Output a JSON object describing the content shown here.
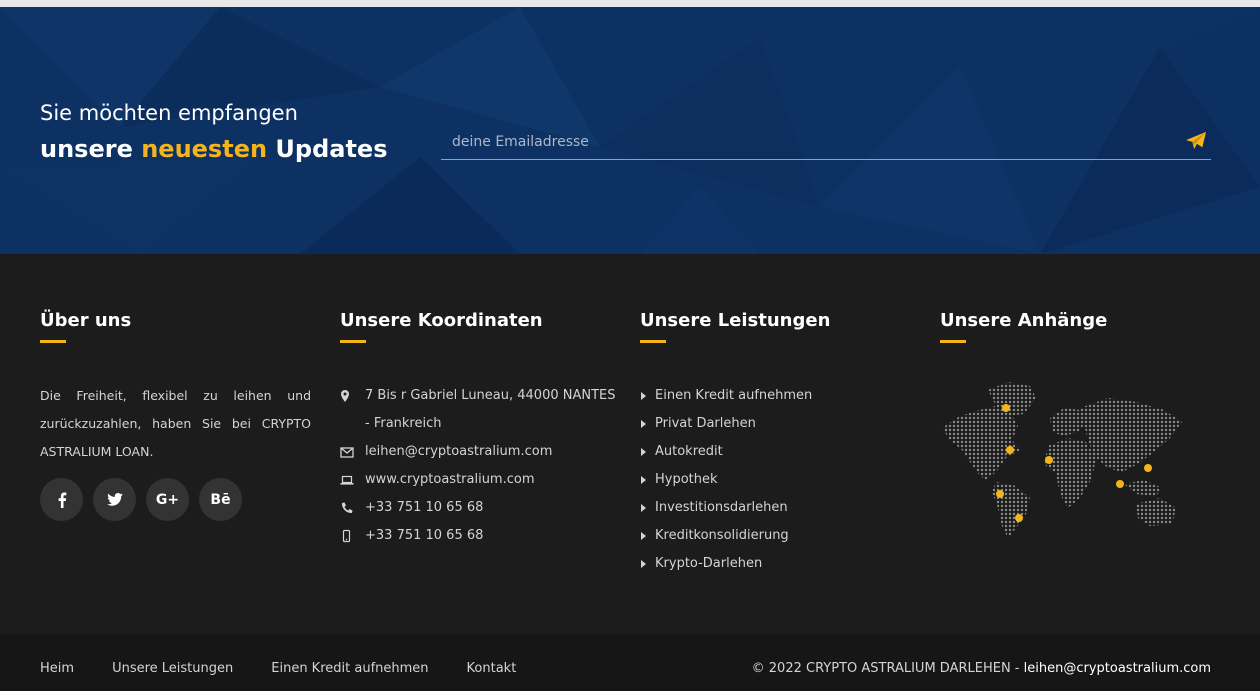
{
  "newsletter": {
    "line1": "Sie möchten empfangen",
    "line2_pre": "unsere ",
    "line2_highlight": "neuesten",
    "line2_post": " Updates",
    "email_placeholder": "deine Emailadresse",
    "send_icon": "paper-plane-icon",
    "bg_color": "#0d3163",
    "accent_color": "#f4b41a"
  },
  "about": {
    "title": "Über uns",
    "text": "Die Freiheit, flexibel zu leihen und zurückzuzahlen, haben Sie bei CRYPTO ASTRALIUM LOAN.",
    "social": [
      {
        "icon": "facebook-icon",
        "glyph": "f"
      },
      {
        "icon": "twitter-icon",
        "glyph": "🐦"
      },
      {
        "icon": "google-plus-icon",
        "glyph": "G+"
      },
      {
        "icon": "behance-icon",
        "glyph": "Bē"
      }
    ]
  },
  "coordinates": {
    "title": "Unsere Koordinaten",
    "items": [
      {
        "icon": "map-marker-icon",
        "text": "7 Bis r Gabriel Luneau, 44000 NANTES - Frankreich"
      },
      {
        "icon": "envelope-icon",
        "text": "leihen@cryptoastralium.com"
      },
      {
        "icon": "laptop-icon",
        "text": "www.cryptoastralium.com"
      },
      {
        "icon": "phone-icon",
        "text": "+33 751 10 65 68"
      },
      {
        "icon": "mobile-icon",
        "text": "+33 751 10 65 68"
      }
    ]
  },
  "services": {
    "title": "Unsere Leistungen",
    "items": [
      "Einen Kredit aufnehmen",
      "Privat Darlehen",
      "Autokredit",
      "Hypothek",
      "Investitionsdarlehen",
      "Kreditkonsolidierung",
      "Krypto-Darlehen"
    ]
  },
  "branches": {
    "title": "Unsere Anhänge",
    "map_icon": "world-map-icon"
  },
  "bottom": {
    "nav": [
      "Heim",
      "Unsere Leistungen",
      "Einen Kredit aufnehmen",
      "Kontakt"
    ],
    "copyright": "© 2022 CRYPTO ASTRALIUM DARLEHEN - ",
    "email": "leihen@cryptoastralium.com"
  }
}
